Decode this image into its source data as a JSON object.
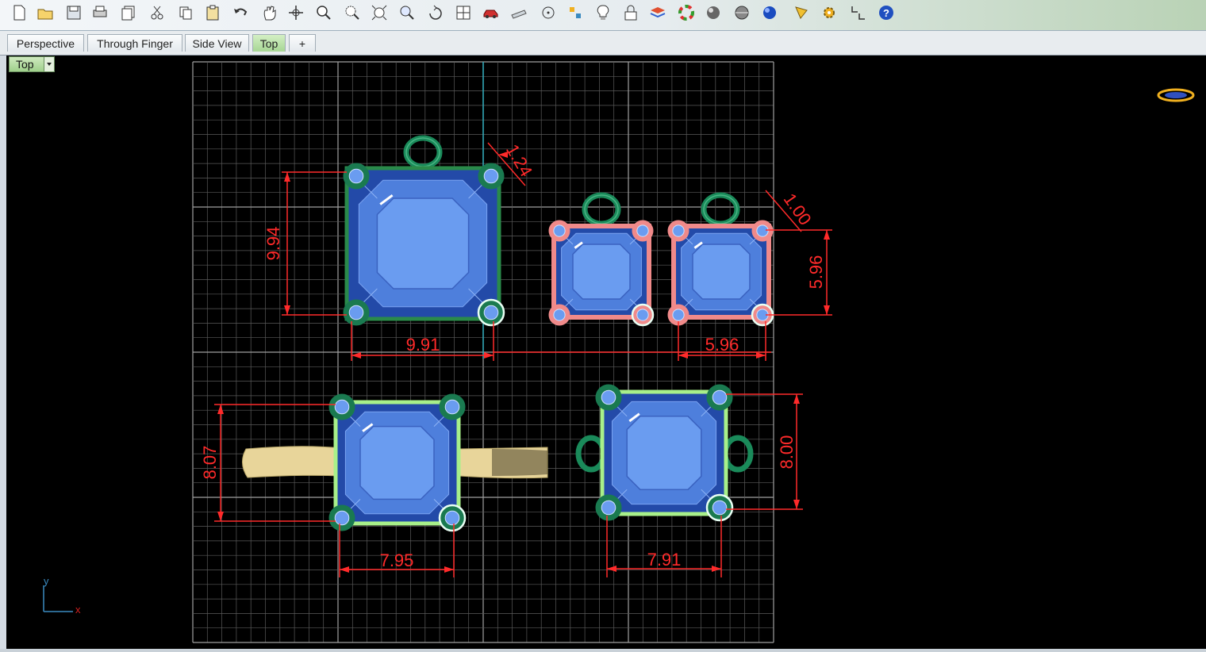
{
  "toolbar": {
    "icons": [
      "new-file-icon",
      "open-folder-icon",
      "save-icon",
      "print-icon",
      "copy-file-icon",
      "cut-icon",
      "copy-icon",
      "paste-icon",
      "undo-icon",
      "pan-hand-icon",
      "move-icon",
      "zoom-icon",
      "zoom-window-icon",
      "zoom-extents-icon",
      "zoom-selected-icon",
      "rotate-view-icon",
      "four-viewports-icon",
      "car-icon",
      "plane-icon",
      "circle-point-icon",
      "dimension-icon",
      "lightbulb-icon",
      "lock-icon",
      "layers-icon",
      "color-wheel-icon",
      "sphere-icon",
      "gray-sphere-icon",
      "blue-sphere-icon",
      "render-spot-icon",
      "gear-icon",
      "snap-icon",
      "help-icon"
    ]
  },
  "tabs": [
    {
      "label": "Perspective",
      "active": false
    },
    {
      "label": "Through Finger",
      "active": false
    },
    {
      "label": "Side View",
      "active": false
    },
    {
      "label": "Top",
      "active": true
    },
    {
      "label": "+",
      "active": false
    }
  ],
  "viewport": {
    "label": "Top",
    "axis_y": "y",
    "axis_x": "x"
  },
  "dimensions": {
    "pendant_large_height": "9.94",
    "pendant_large_width": "9.91",
    "pendant_large_bail": "1.24",
    "earring_small_bail": "1.00",
    "earring_small_height": "5.96",
    "earring_small_width": "5.96",
    "ring_height": "8.07",
    "ring_width": "7.95",
    "connector_height": "8.00",
    "connector_width": "7.91"
  },
  "colors": {
    "grid": "#5a5a5a",
    "grid_major": "#a0a0a0",
    "dimension": "#ff2a2a",
    "gem": "#5b8ee8",
    "frame_green": "#2a8a4a",
    "frame_pink": "#f08a8a",
    "frame_lime": "#a8f08a",
    "band_gold": "#e8d59a"
  }
}
